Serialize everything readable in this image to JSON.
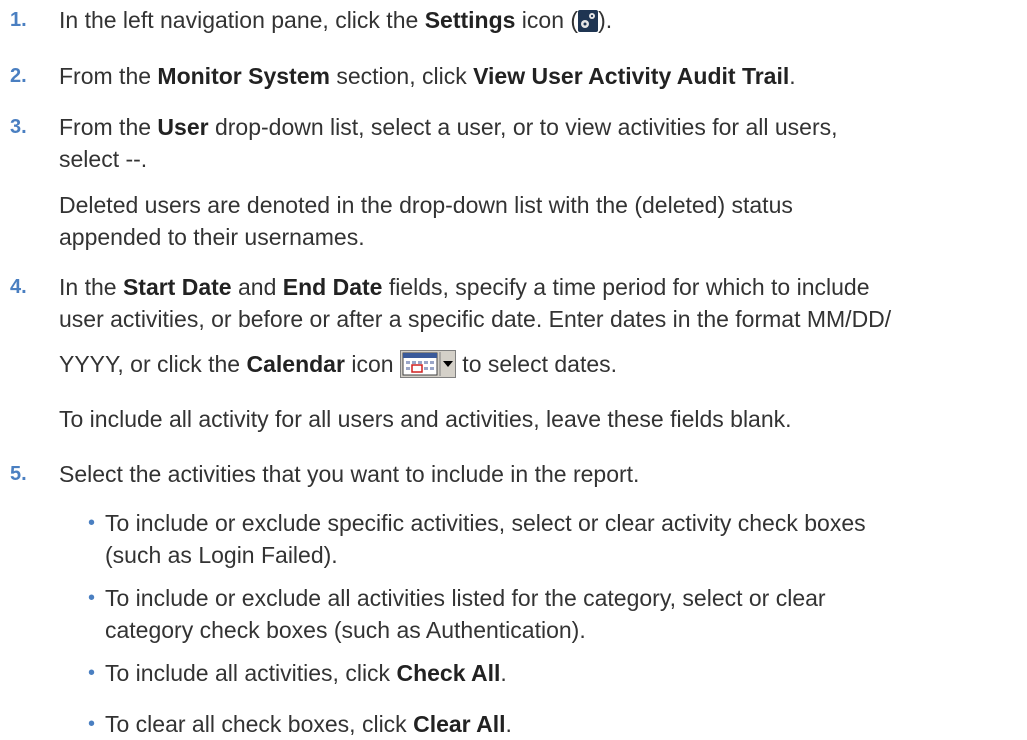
{
  "steps": [
    {
      "number": "1.",
      "t1": "In the left navigation pane, click the ",
      "b1": "Settings",
      "t2": " icon (",
      "t3": ")."
    },
    {
      "number": "2.",
      "t1": "From the ",
      "b1": "Monitor System",
      "t2": " section, click ",
      "b2": "View User Activity Audit Trail",
      "t3": "."
    },
    {
      "number": "3.",
      "t1": "From the ",
      "b1": "User",
      "t2": " drop-down list, select a user, or to view activities for all users,",
      "line2": "select --.",
      "note": "Deleted users are denoted in the drop-down list with the (deleted) status",
      "note2": "appended to their usernames."
    },
    {
      "number": "4.",
      "t1": "In the ",
      "b1": "Start Date",
      "t2": " and ",
      "b2": "End Date",
      "t3": " fields, specify a time period for which to include",
      "line2": "user activities, or before or after a specific date. Enter dates in the format MM/DD/",
      "l3a": "YYYY, or click the ",
      "l3b": "Calendar",
      "l3c": " icon ",
      "l3d": " to select dates.",
      "note": "To include all activity for all users and activities, leave these fields blank."
    },
    {
      "number": "5.",
      "text": "Select the activities that you want to include in the report.",
      "bullets": [
        {
          "bullet": "•",
          "line1": "To include or exclude specific activities, select or clear activity check boxes",
          "line2": "(such as Login Failed)."
        },
        {
          "bullet": "•",
          "line1": "To include or exclude all activities listed for the category, select or clear",
          "line2": "category check boxes (such as Authentication)."
        },
        {
          "bullet": "•",
          "t1": "To include all activities, click ",
          "b1": "Check All",
          "t2": "."
        },
        {
          "bullet": "•",
          "t1": "To clear all check boxes, click ",
          "b1": "Clear All",
          "t2": "."
        }
      ]
    }
  ],
  "icons": {
    "settings": "settings-gear-icon",
    "calendar": "calendar-dropdown-icon"
  },
  "colors": {
    "step_number": "#4a7fc1",
    "text": "#333333",
    "icon_bg": "#1f3552"
  }
}
